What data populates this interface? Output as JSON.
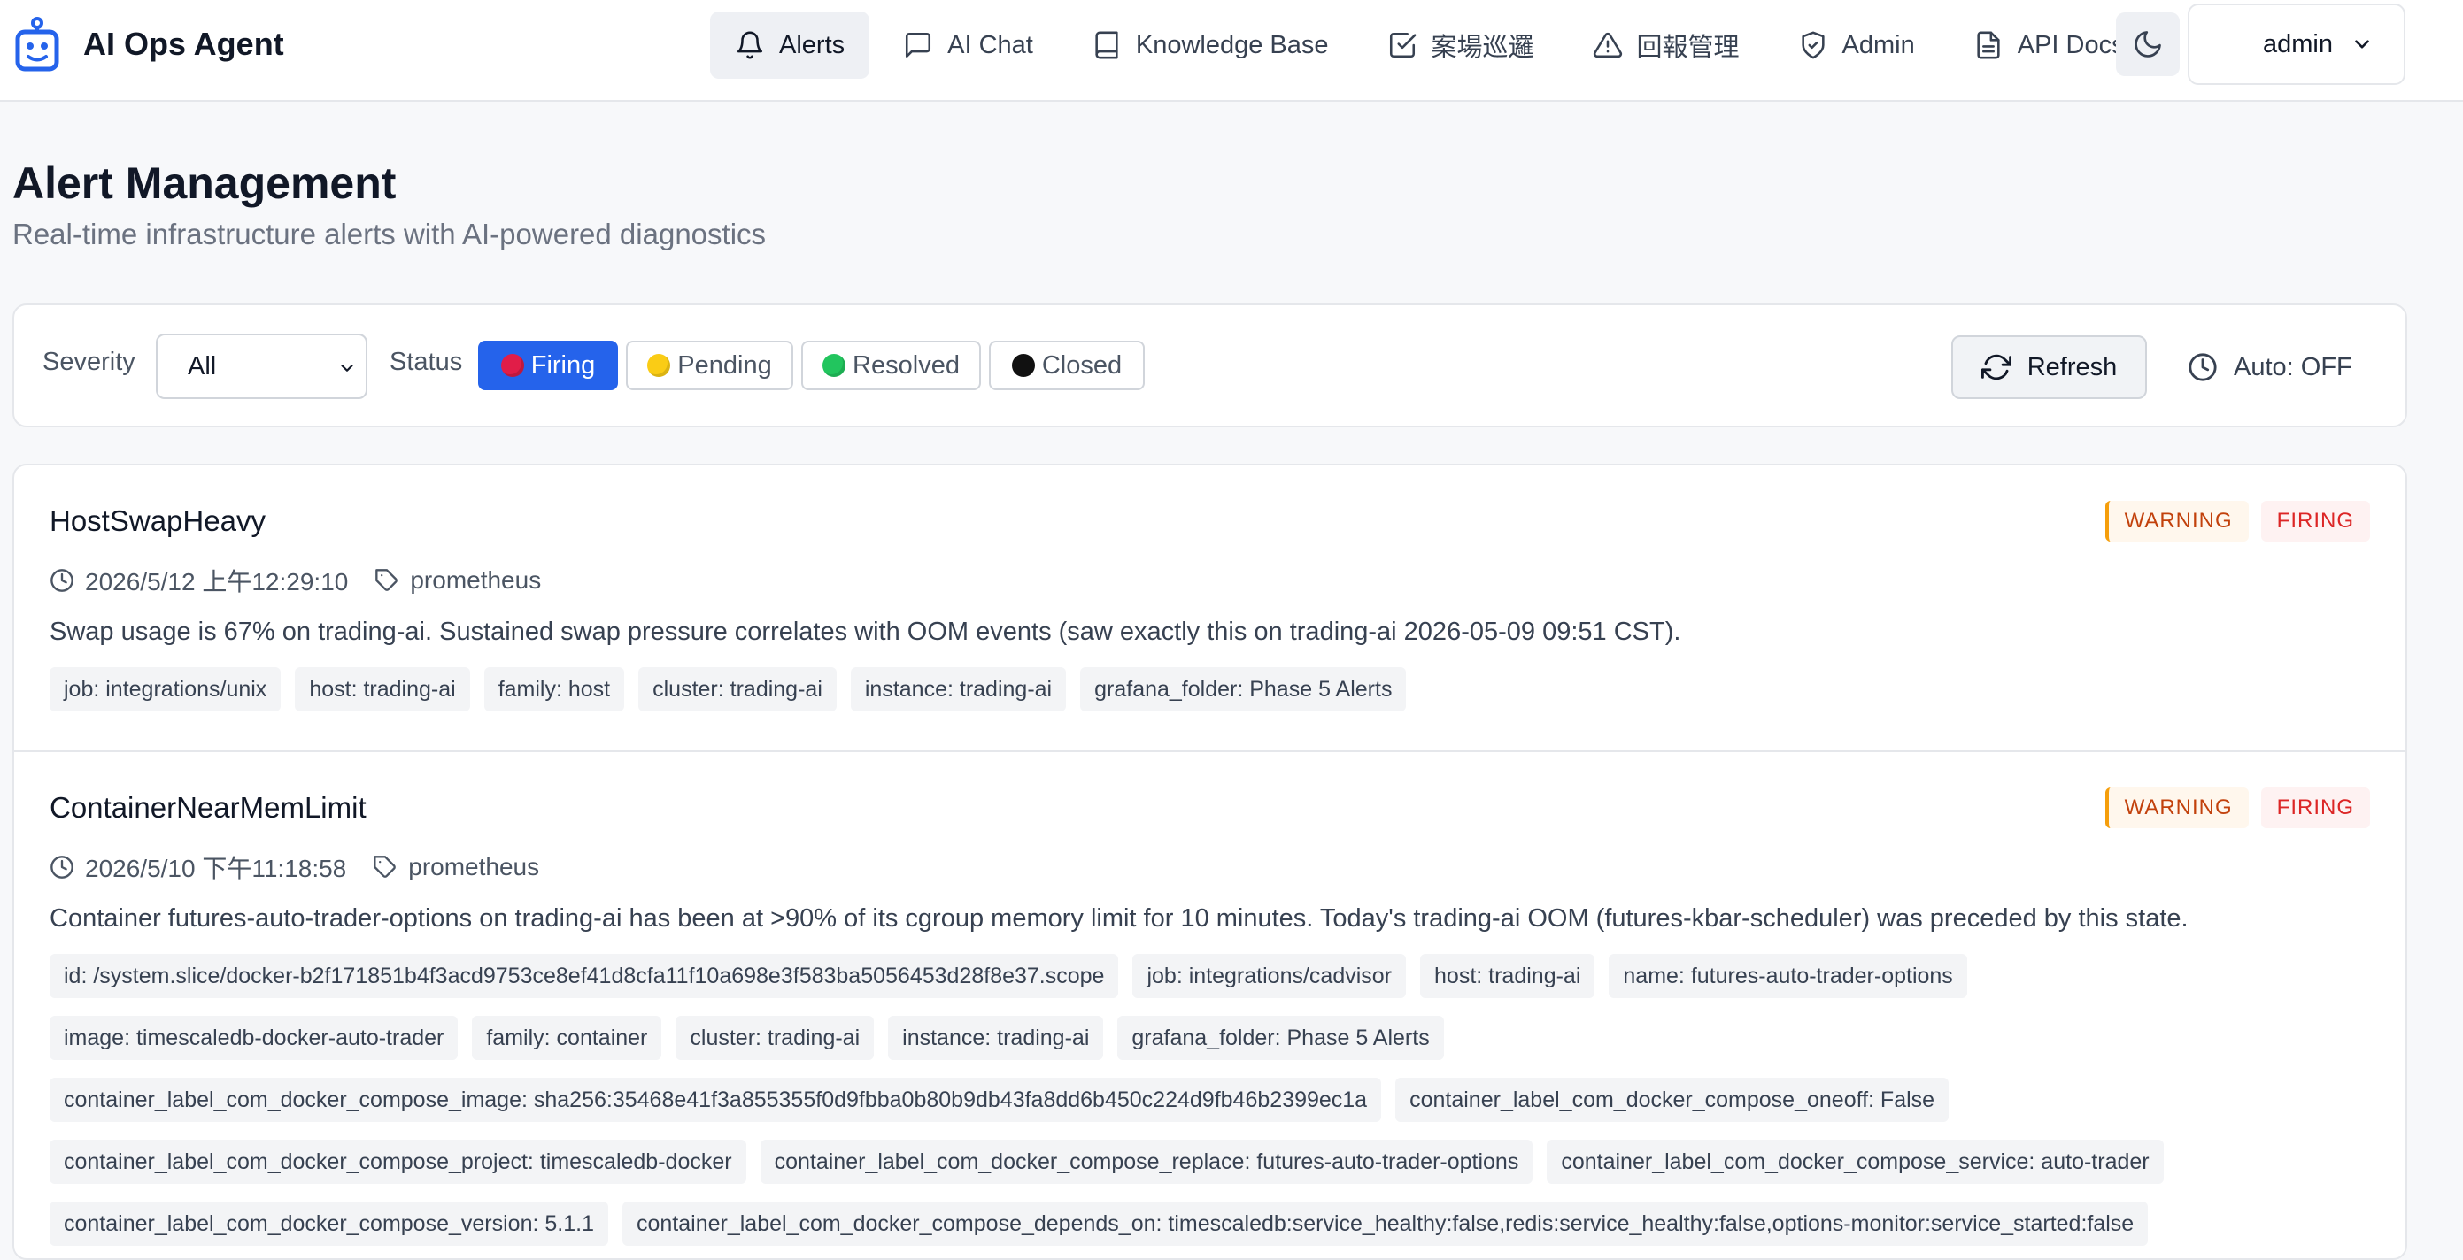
{
  "app": {
    "name": "AI Ops Agent"
  },
  "nav": [
    {
      "label": "Alerts",
      "icon": "bell-icon",
      "active": true
    },
    {
      "label": "AI Chat",
      "icon": "message-icon"
    },
    {
      "label": "Knowledge Base",
      "icon": "book-icon"
    },
    {
      "label": "案場巡邏",
      "icon": "checkbox-icon"
    },
    {
      "label": "回報管理",
      "icon": "warning-triangle-icon"
    },
    {
      "label": "Admin",
      "icon": "shield-icon"
    },
    {
      "label": "API Docs",
      "icon": "document-icon"
    }
  ],
  "header": {
    "theme_icon": "moon-icon",
    "user": "admin"
  },
  "page": {
    "title": "Alert Management",
    "subtitle": "Real-time infrastructure alerts with AI-powered diagnostics"
  },
  "filters": {
    "severity_label": "Severity",
    "severity_value": "All",
    "status_label": "Status",
    "statuses": [
      {
        "label": "Firing",
        "color": "#e11d48",
        "active": true
      },
      {
        "label": "Pending",
        "color": "#facc15",
        "active": false
      },
      {
        "label": "Resolved",
        "color": "#22c55e",
        "active": false
      },
      {
        "label": "Closed",
        "color": "#111111",
        "active": false
      }
    ],
    "refresh_label": "Refresh",
    "auto_label": "Auto: OFF"
  },
  "colors": {
    "accent": "#2563eb",
    "warning": "#c2410c",
    "firing": "#dc2626"
  },
  "alerts": [
    {
      "name": "HostSwapHeavy",
      "severity": "WARNING",
      "state": "FIRING",
      "time": "2026/5/12 上午12:29:10",
      "source": "prometheus",
      "summary": "Swap usage is 67% on trading-ai. Sustained swap pressure correlates with OOM events (saw exactly this on trading-ai 2026-05-09 09:51 CST).",
      "labels": [
        "job: integrations/unix",
        "host: trading-ai",
        "family: host",
        "cluster: trading-ai",
        "instance: trading-ai",
        "grafana_folder: Phase 5 Alerts"
      ]
    },
    {
      "name": "ContainerNearMemLimit",
      "severity": "WARNING",
      "state": "FIRING",
      "time": "2026/5/10 下午11:18:58",
      "source": "prometheus",
      "summary": "Container futures-auto-trader-options on trading-ai has been at >90% of its cgroup memory limit for 10 minutes. Today's trading-ai OOM (futures-kbar-scheduler) was preceded by this state.",
      "labels": [
        "id: /system.slice/docker-b2f171851b4f3acd9753ce8ef41d8cfa11f10a698e3f583ba5056453d28f8e37.scope",
        "job: integrations/cadvisor",
        "host: trading-ai",
        "name: futures-auto-trader-options",
        "image: timescaledb-docker-auto-trader",
        "family: container",
        "cluster: trading-ai",
        "instance: trading-ai",
        "grafana_folder: Phase 5 Alerts",
        "container_label_com_docker_compose_image: sha256:35468e41f3a855355f0d9fbba0b80b9db43fa8dd6b450c224d9fb46b2399ec1a",
        "container_label_com_docker_compose_oneoff: False",
        "container_label_com_docker_compose_project: timescaledb-docker",
        "container_label_com_docker_compose_replace: futures-auto-trader-options",
        "container_label_com_docker_compose_service: auto-trader",
        "container_label_com_docker_compose_version: 5.1.1",
        "container_label_com_docker_compose_depends_on: timescaledb:service_healthy:false,redis:service_healthy:false,options-monitor:service_started:false"
      ]
    }
  ]
}
